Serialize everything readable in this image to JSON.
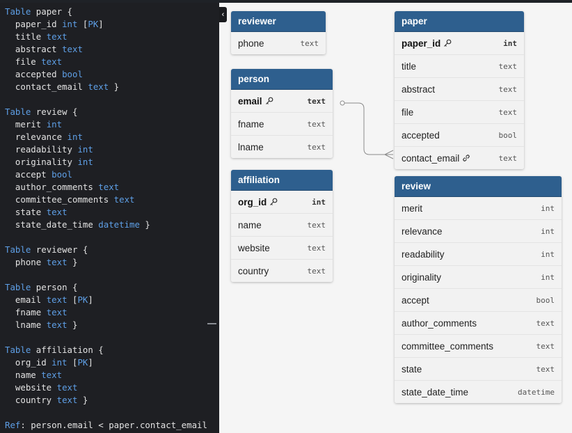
{
  "editor": {
    "lines": [
      [
        {
          "t": "Table",
          "c": "kw"
        },
        {
          "t": " paper {",
          "c": ""
        }
      ],
      [
        {
          "t": "  paper_id ",
          "c": ""
        },
        {
          "t": "int",
          "c": "ty"
        },
        {
          "t": " [",
          "c": ""
        },
        {
          "t": "PK",
          "c": "pk"
        },
        {
          "t": "]",
          "c": ""
        }
      ],
      [
        {
          "t": "  title ",
          "c": ""
        },
        {
          "t": "text",
          "c": "ty"
        }
      ],
      [
        {
          "t": "  abstract ",
          "c": ""
        },
        {
          "t": "text",
          "c": "ty"
        }
      ],
      [
        {
          "t": "  file ",
          "c": ""
        },
        {
          "t": "text",
          "c": "ty"
        }
      ],
      [
        {
          "t": "  accepted ",
          "c": ""
        },
        {
          "t": "bool",
          "c": "ty"
        }
      ],
      [
        {
          "t": "  contact_email ",
          "c": ""
        },
        {
          "t": "text",
          "c": "ty"
        },
        {
          "t": " }",
          "c": ""
        }
      ],
      [],
      [
        {
          "t": "Table",
          "c": "kw"
        },
        {
          "t": " review {",
          "c": ""
        }
      ],
      [
        {
          "t": "  merit ",
          "c": ""
        },
        {
          "t": "int",
          "c": "ty"
        }
      ],
      [
        {
          "t": "  relevance ",
          "c": ""
        },
        {
          "t": "int",
          "c": "ty"
        }
      ],
      [
        {
          "t": "  readability ",
          "c": ""
        },
        {
          "t": "int",
          "c": "ty"
        }
      ],
      [
        {
          "t": "  originality ",
          "c": ""
        },
        {
          "t": "int",
          "c": "ty"
        }
      ],
      [
        {
          "t": "  accept ",
          "c": ""
        },
        {
          "t": "bool",
          "c": "ty"
        }
      ],
      [
        {
          "t": "  author_comments ",
          "c": ""
        },
        {
          "t": "text",
          "c": "ty"
        }
      ],
      [
        {
          "t": "  committee_comments ",
          "c": ""
        },
        {
          "t": "text",
          "c": "ty"
        }
      ],
      [
        {
          "t": "  state ",
          "c": ""
        },
        {
          "t": "text",
          "c": "ty"
        }
      ],
      [
        {
          "t": "  state_date_time ",
          "c": ""
        },
        {
          "t": "datetime",
          "c": "ty"
        },
        {
          "t": " }",
          "c": ""
        }
      ],
      [],
      [
        {
          "t": "Table",
          "c": "kw"
        },
        {
          "t": " reviewer {",
          "c": ""
        }
      ],
      [
        {
          "t": "  phone ",
          "c": ""
        },
        {
          "t": "text",
          "c": "ty"
        },
        {
          "t": " }",
          "c": ""
        }
      ],
      [],
      [
        {
          "t": "Table",
          "c": "kw"
        },
        {
          "t": " person {",
          "c": ""
        }
      ],
      [
        {
          "t": "  email ",
          "c": ""
        },
        {
          "t": "text",
          "c": "ty"
        },
        {
          "t": " [",
          "c": ""
        },
        {
          "t": "PK",
          "c": "pk"
        },
        {
          "t": "]",
          "c": ""
        }
      ],
      [
        {
          "t": "  fname ",
          "c": ""
        },
        {
          "t": "text",
          "c": "ty"
        }
      ],
      [
        {
          "t": "  lname ",
          "c": ""
        },
        {
          "t": "text",
          "c": "ty"
        },
        {
          "t": " }",
          "c": ""
        }
      ],
      [],
      [
        {
          "t": "Table",
          "c": "kw"
        },
        {
          "t": " affiliation {",
          "c": ""
        }
      ],
      [
        {
          "t": "  org_id ",
          "c": ""
        },
        {
          "t": "int",
          "c": "ty"
        },
        {
          "t": " [",
          "c": ""
        },
        {
          "t": "PK",
          "c": "pk"
        },
        {
          "t": "]",
          "c": ""
        }
      ],
      [
        {
          "t": "  name ",
          "c": ""
        },
        {
          "t": "text",
          "c": "ty"
        }
      ],
      [
        {
          "t": "  website ",
          "c": ""
        },
        {
          "t": "text",
          "c": "ty"
        }
      ],
      [
        {
          "t": "  country ",
          "c": ""
        },
        {
          "t": "text",
          "c": "ty"
        },
        {
          "t": " }",
          "c": ""
        }
      ],
      [],
      [
        {
          "t": "Ref",
          "c": "kw"
        },
        {
          "t": ": person.email < paper.contact_email",
          "c": ""
        }
      ]
    ]
  },
  "collapse_button": {
    "label": "‹"
  },
  "tables": {
    "reviewer": {
      "title": "reviewer",
      "fields": [
        {
          "name": "phone",
          "type": "text"
        }
      ]
    },
    "person": {
      "title": "person",
      "fields": [
        {
          "name": "email",
          "type": "text",
          "pk": true
        },
        {
          "name": "fname",
          "type": "text"
        },
        {
          "name": "lname",
          "type": "text"
        }
      ]
    },
    "affiliation": {
      "title": "affiliation",
      "fields": [
        {
          "name": "org_id",
          "type": "int",
          "pk": true
        },
        {
          "name": "name",
          "type": "text"
        },
        {
          "name": "website",
          "type": "text"
        },
        {
          "name": "country",
          "type": "text"
        }
      ]
    },
    "paper": {
      "title": "paper",
      "fields": [
        {
          "name": "paper_id",
          "type": "int",
          "pk": true
        },
        {
          "name": "title",
          "type": "text"
        },
        {
          "name": "abstract",
          "type": "text"
        },
        {
          "name": "file",
          "type": "text"
        },
        {
          "name": "accepted",
          "type": "bool"
        },
        {
          "name": "contact_email",
          "type": "text",
          "fk": true
        }
      ]
    },
    "review": {
      "title": "review",
      "fields": [
        {
          "name": "merit",
          "type": "int"
        },
        {
          "name": "relevance",
          "type": "int"
        },
        {
          "name": "readability",
          "type": "int"
        },
        {
          "name": "originality",
          "type": "int"
        },
        {
          "name": "accept",
          "type": "bool"
        },
        {
          "name": "author_comments",
          "type": "text"
        },
        {
          "name": "committee_comments",
          "type": "text"
        },
        {
          "name": "state",
          "type": "text"
        },
        {
          "name": "state_date_time",
          "type": "datetime"
        }
      ]
    }
  },
  "colors": {
    "header": "#2e5f8e",
    "editor_bg": "#1e1f23",
    "keyword": "#5e9fe6"
  }
}
